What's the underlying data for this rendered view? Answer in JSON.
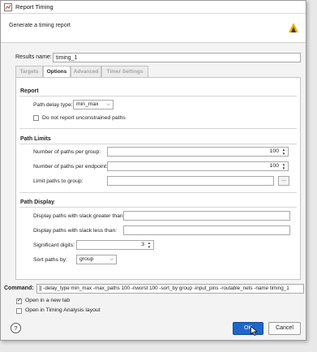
{
  "window": {
    "title": "Report Timing",
    "description": "Generate a timing report"
  },
  "results": {
    "label": "Results name:",
    "value": "timing_1"
  },
  "tabs": [
    {
      "label": "Targets"
    },
    {
      "label": "Options"
    },
    {
      "label": "Advanced"
    },
    {
      "label": "Timer Settings"
    }
  ],
  "report": {
    "title": "Report",
    "path_delay_label": "Path delay type:",
    "path_delay_value": "min_max",
    "unconstrained_label": "Do not report unconstrained paths",
    "unconstrained_checked": false
  },
  "path_limits": {
    "title": "Path Limits",
    "paths_per_group_label": "Number of paths per group:",
    "paths_per_group_value": "100",
    "paths_per_endpoint_label": "Number of paths per endpoint:",
    "paths_per_endpoint_value": "100",
    "limit_group_label": "Limit paths to group:",
    "limit_group_value": "",
    "browse_label": "..."
  },
  "path_display": {
    "title": "Path Display",
    "slack_greater_label": "Display paths with slack greater than:",
    "slack_greater_value": "",
    "slack_less_label": "Display paths with slack less than:",
    "slack_less_value": "",
    "sig_digits_label": "Significant digits:",
    "sig_digits_value": "3",
    "sort_by_label": "Sort paths by:",
    "sort_by_value": "group"
  },
  "command": {
    "label": "Command:",
    "value": "]] -delay_type min_max -max_paths 100 -nworst 100 -sort_by group -input_pins -routable_nets -name timing_1"
  },
  "footer": {
    "open_new_tab_label": "Open in a new tab",
    "open_new_tab_checked": true,
    "open_layout_label": "Open in Timing Analysis layout",
    "open_layout_checked": false,
    "help_label": "?",
    "ok_label": "OK",
    "cancel_label": "Cancel"
  },
  "colors": {
    "ok_button": "#1f66c9",
    "logo_yellow": "#e8b400"
  },
  "icons": [
    "report-timing-icon",
    "vivado-logo-icon",
    "help-icon",
    "mouse-cursor-icon"
  ]
}
